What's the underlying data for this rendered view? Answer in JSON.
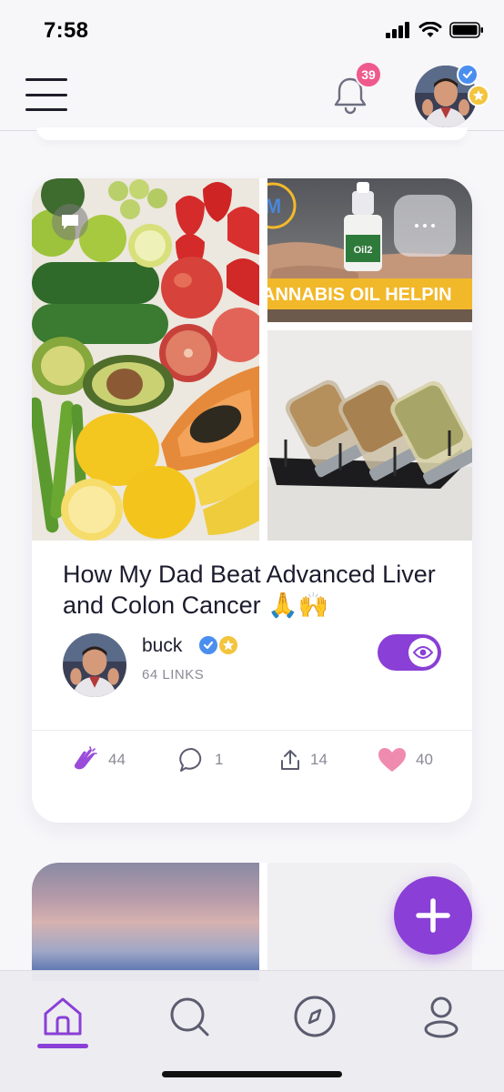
{
  "status_bar": {
    "time": "7:58"
  },
  "header": {
    "notification_count": "39"
  },
  "post": {
    "title": "How My Dad Beat Advanced Liver and Colon Cancer 🙏🙌",
    "image_top_right_text": "ANNABIS OIL HELPIN",
    "image_top_right_circle": "M",
    "bottle_label": "Oil2",
    "author": {
      "name": "buck",
      "links": "64 LINKS"
    },
    "visibility_on": true,
    "actions": {
      "claps": "44",
      "comments": "1",
      "shares": "14",
      "likes": "40"
    }
  },
  "colors": {
    "accent": "#8a3fd6",
    "badge": "#ef5a8c",
    "heart": "#f08bb0",
    "verified": "#4a8ff0",
    "star": "#f3c43c"
  },
  "nav": {
    "items": [
      "home-icon",
      "search-icon",
      "compass-icon",
      "profile-icon"
    ],
    "active": "home"
  }
}
